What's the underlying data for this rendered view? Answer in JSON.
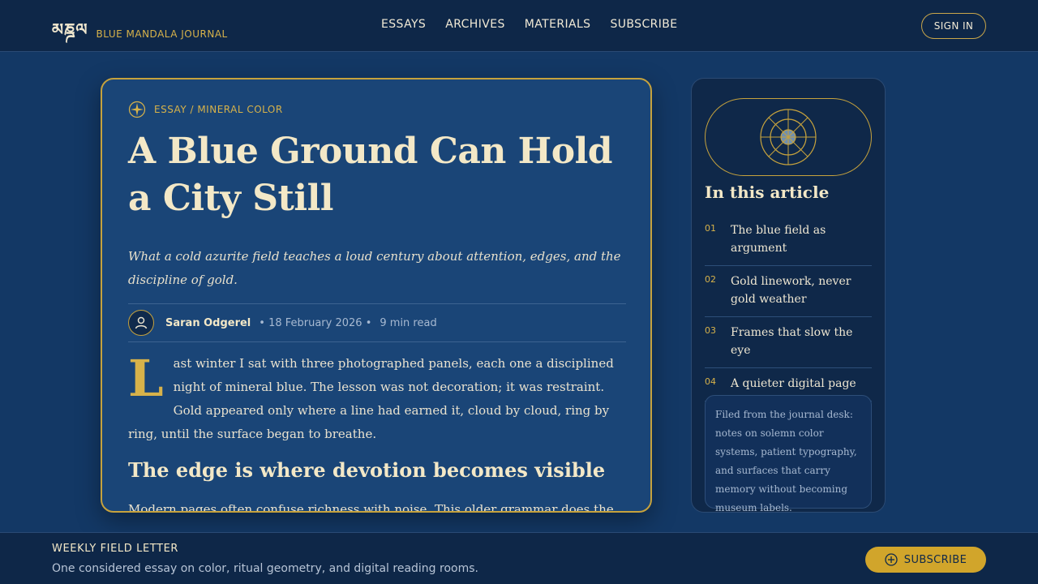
{
  "header": {
    "brand_mark": "མཎྜལ",
    "brand_name": "BLUE MANDALA JOURNAL",
    "nav": [
      "ESSAYS",
      "ARCHIVES",
      "MATERIALS",
      "SUBSCRIBE"
    ],
    "sign_in": "SIGN IN"
  },
  "article": {
    "kicker": "ESSAY / MINERAL COLOR",
    "title": "A Blue Ground Can Hold a City Still",
    "dek": "What a cold azurite field teaches a loud century about attention, edges, and the discipline of gold.",
    "author": "Saran Odgerel",
    "date": "• 18 February 2026 •",
    "read_time": "9 min read",
    "dropcap": "L",
    "lede": "ast winter I sat with three photographed panels, each one a disciplined night of mineral blue. The lesson was not decoration; it was restraint. Gold appeared only where a line had earned it, cloud by cloud, ring by ring, until the surface began to breathe.",
    "h2": "The edge is where devotion becomes visible",
    "para": "Modern pages often confuse richness with noise. This older grammar does the opposite: a saturated ground, a measured frame, and small red or green notes held in reserve. The"
  },
  "sidebar": {
    "toc_title": "In this article",
    "items": [
      {
        "num": "01",
        "label": "The blue field as argument"
      },
      {
        "num": "02",
        "label": "Gold linework, never gold weather"
      },
      {
        "num": "03",
        "label": "Frames that slow the eye"
      },
      {
        "num": "04",
        "label": "A quieter digital page"
      }
    ],
    "note": "Filed from the journal desk: notes on solemn color systems, patient typography, and surfaces that carry memory without becoming museum labels."
  },
  "footer": {
    "title": "WEEKLY FIELD LETTER",
    "subtitle": "One considered essay on color, ritual geometry, and digital reading rooms.",
    "subscribe": "SUBSCRIBE"
  },
  "colors": {
    "background": "#133865",
    "card": "#1a4577",
    "gold": "#d7b24a",
    "cream": "#f3e8c7"
  }
}
